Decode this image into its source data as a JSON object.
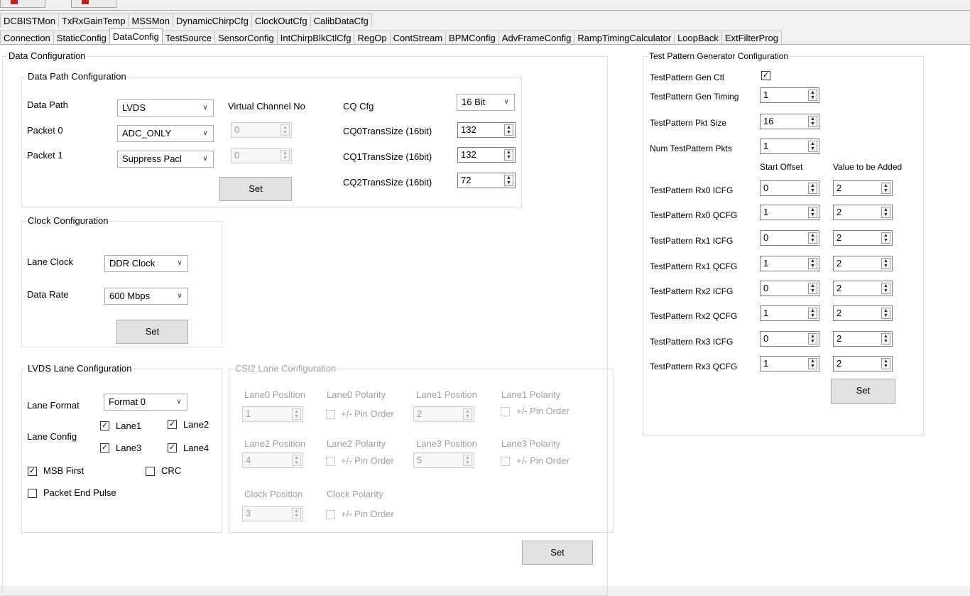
{
  "tabs_row1": [
    "DCBISTMon",
    "TxRxGainTemp",
    "MSSMon",
    "DynamicChirpCfg",
    "ClockOutCfg",
    "CalibDataCfg"
  ],
  "tabs_row2": [
    "Connection",
    "StaticConfig",
    "DataConfig",
    "TestSource",
    "SensorConfig",
    "IntChirpBlkCtlCfg",
    "RegOp",
    "ContStream",
    "BPMConfig",
    "AdvFrameConfig",
    "RampTimingCalculator",
    "LoopBack",
    "ExtFilterProg"
  ],
  "active_tab": "DataConfig",
  "data_configuration": {
    "title": "Data Configuration",
    "data_path_group": {
      "title": "Data Path Configuration",
      "data_path_label": "Data Path",
      "data_path_value": "LVDS",
      "packet0_label": "Packet 0",
      "packet0_value": "ADC_ONLY",
      "packet1_label": "Packet 1",
      "packet1_value": "Suppress Pacl",
      "virtual_channel_label": "Virtual Channel No",
      "vc0_value": "0",
      "vc1_value": "0",
      "cq_cfg_label": "CQ Cfg",
      "cq_cfg_value": "16 Bit",
      "cq0_label": "CQ0TransSize (16bit)",
      "cq0_value": "132",
      "cq1_label": "CQ1TransSize (16bit)",
      "cq1_value": "132",
      "cq2_label": "CQ2TransSize (16bit)",
      "cq2_value": "72",
      "set_label": "Set"
    },
    "clock_group": {
      "title": "Clock Configuration",
      "lane_clock_label": "Lane Clock",
      "lane_clock_value": "DDR Clock",
      "data_rate_label": "Data Rate",
      "data_rate_value": "600 Mbps",
      "set_label": "Set"
    },
    "lvds_group": {
      "title": "LVDS Lane Configuration",
      "lane_format_label": "Lane Format",
      "lane_format_value": "Format 0",
      "lane_config_label": "Lane Config",
      "lane1": "Lane1",
      "lane2": "Lane2",
      "lane3": "Lane3",
      "lane4": "Lane4",
      "msb_first": "MSB First",
      "crc": "CRC",
      "packet_end_pulse": "Packet End Pulse"
    },
    "csi2_group": {
      "title": "CSI2 Lane Configuration",
      "lane0_position": "Lane0 Position",
      "lane0_polarity": "Lane0 Polarity",
      "lane1_position": "Lane1 Position",
      "lane1_polarity": "Lane1 Polarity",
      "lane2_position": "Lane2 Position",
      "lane2_polarity": "Lane2 Polarity",
      "lane3_position": "Lane3 Position",
      "lane3_polarity": "Lane3 Polarity",
      "clock_position": "Clock Position",
      "clock_polarity": "Clock Polarity",
      "lane0_pos_value": "1",
      "lane1_pos_value": "2",
      "lane2_pos_value": "4",
      "lane3_pos_value": "5",
      "clock_pos_value": "3",
      "pin_order": "+/- Pin Order"
    },
    "set_label": "Set"
  },
  "test_pattern": {
    "title": "Test Pattern Generator Configuration",
    "gen_ctl_label": "TestPattern Gen Ctl",
    "gen_timing_label": "TestPattern Gen Timing",
    "gen_timing_value": "1",
    "pkt_size_label": "TestPattern Pkt Size",
    "pkt_size_value": "16",
    "num_pkts_label": "Num TestPattern Pkts",
    "num_pkts_value": "1",
    "start_offset_header": "Start Offset",
    "value_added_header": "Value to be Added",
    "rows": [
      {
        "label": "TestPattern Rx0 ICFG",
        "offset": "0",
        "added": "2"
      },
      {
        "label": "TestPattern Rx0 QCFG",
        "offset": "1",
        "added": "2"
      },
      {
        "label": "TestPattern Rx1 ICFG",
        "offset": "0",
        "added": "2"
      },
      {
        "label": "TestPattern Rx1 QCFG",
        "offset": "1",
        "added": "2"
      },
      {
        "label": "TestPattern Rx2 ICFG",
        "offset": "0",
        "added": "2"
      },
      {
        "label": "TestPattern Rx2 QCFG",
        "offset": "1",
        "added": "2"
      },
      {
        "label": "TestPattern Rx3 ICFG",
        "offset": "0",
        "added": "2"
      },
      {
        "label": "TestPattern Rx3 QCFG",
        "offset": "1",
        "added": "2"
      }
    ],
    "set_label": "Set"
  }
}
